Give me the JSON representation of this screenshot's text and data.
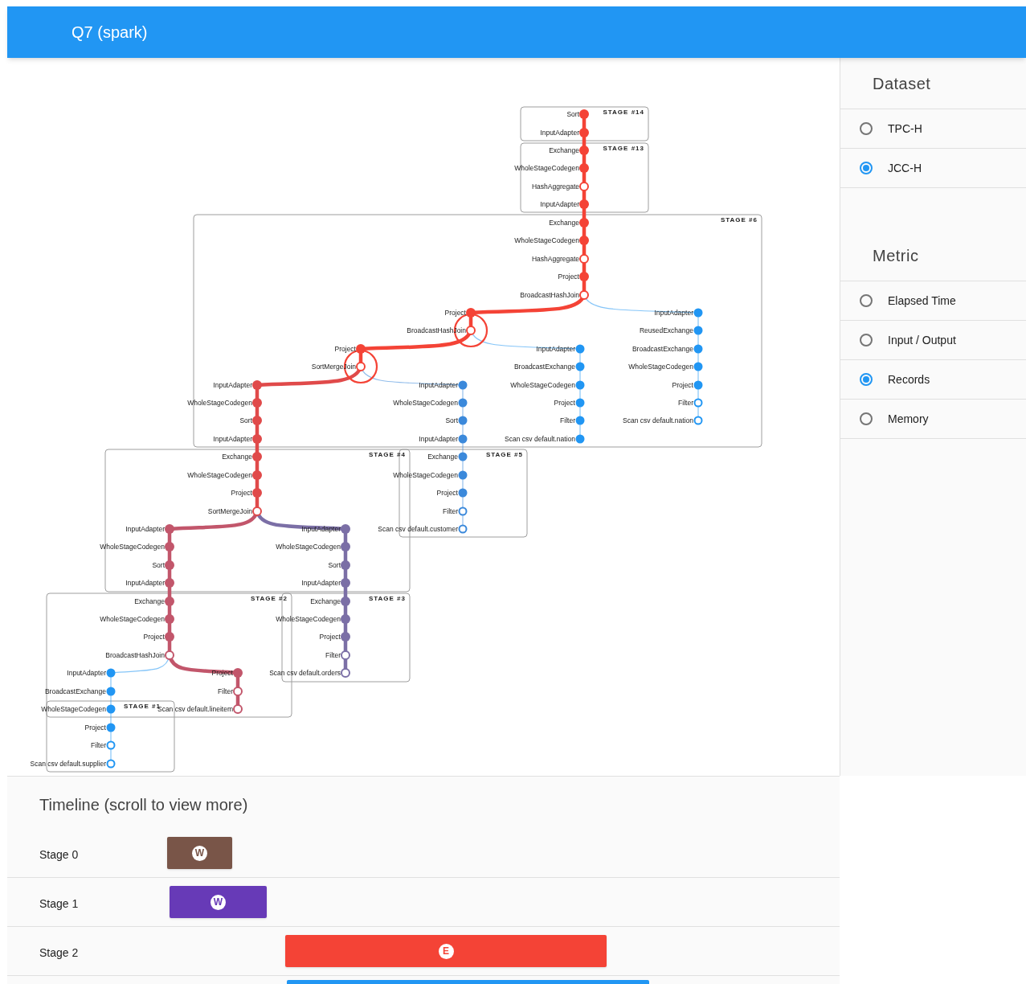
{
  "header": {
    "title": "Q7 (spark)"
  },
  "plan": {
    "stages": [
      {
        "label": "STAGE #14"
      },
      {
        "label": "STAGE #13"
      },
      {
        "label": "STAGE #6"
      },
      {
        "label": "STAGE #4"
      },
      {
        "label": "STAGE #5"
      },
      {
        "label": "STAGE #2"
      },
      {
        "label": "STAGE #3"
      },
      {
        "label": "STAGE #1"
      }
    ],
    "tree": [
      {
        "color": "#f44336",
        "thick": true,
        "nodes": [
          {
            "label": "Sort",
            "filled": true,
            "highlighted": false
          },
          {
            "label": "InputAdapter",
            "filled": true,
            "highlighted": false
          },
          {
            "label": "Exchange",
            "filled": true,
            "highlighted": false
          },
          {
            "label": "WholeStageCodegen",
            "filled": true,
            "highlighted": false
          },
          {
            "label": "HashAggregate",
            "filled": false,
            "highlighted": false
          },
          {
            "label": "InputAdapter",
            "filled": true,
            "highlighted": false
          },
          {
            "label": "Exchange",
            "filled": true,
            "highlighted": false
          },
          {
            "label": "WholeStageCodegen",
            "filled": true,
            "highlighted": false
          },
          {
            "label": "HashAggregate",
            "filled": false,
            "highlighted": false
          },
          {
            "label": "Project",
            "filled": true,
            "highlighted": false
          },
          {
            "label": "BroadcastHashJoin",
            "filled": false,
            "highlighted": false
          }
        ],
        "children": [
          {
            "color": "#f44336",
            "thick": true,
            "nodes": [
              {
                "label": "Project",
                "filled": true,
                "highlighted": false
              },
              {
                "label": "BroadcastHashJoin",
                "filled": false,
                "highlighted": true
              }
            ],
            "children": [
              {
                "color": "#f44336",
                "thick": true,
                "nodes": [
                  {
                    "label": "Project",
                    "filled": true,
                    "highlighted": false
                  },
                  {
                    "label": "SortMergeJoin",
                    "filled": false,
                    "highlighted": true
                  }
                ],
                "children": [
                  {
                    "color": "#e04a4a",
                    "thick": true,
                    "nodes": [
                      {
                        "label": "InputAdapter",
                        "filled": true,
                        "highlighted": false
                      },
                      {
                        "label": "WholeStageCodegen",
                        "filled": true,
                        "highlighted": false
                      },
                      {
                        "label": "Sort",
                        "filled": true,
                        "highlighted": false
                      },
                      {
                        "label": "InputAdapter",
                        "filled": true,
                        "highlighted": false
                      },
                      {
                        "label": "Exchange",
                        "filled": true,
                        "highlighted": false
                      },
                      {
                        "label": "WholeStageCodegen",
                        "filled": true,
                        "highlighted": false
                      },
                      {
                        "label": "Project",
                        "filled": true,
                        "highlighted": false
                      },
                      {
                        "label": "SortMergeJoin",
                        "filled": false,
                        "highlighted": false
                      }
                    ],
                    "children": [
                      {
                        "color": "#c2566b",
                        "thick": true,
                        "nodes": [
                          {
                            "label": "InputAdapter",
                            "filled": true,
                            "highlighted": false
                          },
                          {
                            "label": "WholeStageCodegen",
                            "filled": true,
                            "highlighted": false
                          },
                          {
                            "label": "Sort",
                            "filled": true,
                            "highlighted": false
                          },
                          {
                            "label": "InputAdapter",
                            "filled": true,
                            "highlighted": false
                          },
                          {
                            "label": "Exchange",
                            "filled": true,
                            "highlighted": false
                          },
                          {
                            "label": "WholeStageCodegen",
                            "filled": true,
                            "highlighted": false
                          },
                          {
                            "label": "Project",
                            "filled": true,
                            "highlighted": false
                          },
                          {
                            "label": "BroadcastHashJoin",
                            "filled": false,
                            "highlighted": false
                          }
                        ],
                        "children": [
                          {
                            "color": "#2196f3",
                            "thick": false,
                            "nodes": [
                              {
                                "label": "InputAdapter",
                                "filled": true,
                                "highlighted": false
                              },
                              {
                                "label": "BroadcastExchange",
                                "filled": true,
                                "highlighted": false
                              },
                              {
                                "label": "WholeStageCodegen",
                                "filled": true,
                                "highlighted": false
                              },
                              {
                                "label": "Project",
                                "filled": true,
                                "highlighted": false
                              },
                              {
                                "label": "Filter",
                                "filled": false,
                                "highlighted": false
                              },
                              {
                                "label": "Scan csv default.supplier",
                                "filled": false,
                                "highlighted": false
                              }
                            ]
                          },
                          {
                            "color": "#c2566b",
                            "thick": true,
                            "nodes": [
                              {
                                "label": "Project",
                                "filled": true,
                                "highlighted": false
                              },
                              {
                                "label": "Filter",
                                "filled": false,
                                "highlighted": false
                              },
                              {
                                "label": "Scan csv default.lineitem",
                                "filled": false,
                                "highlighted": false
                              }
                            ]
                          }
                        ]
                      },
                      {
                        "color": "#7b6fa6",
                        "thick": true,
                        "nodes": [
                          {
                            "label": "InputAdapter",
                            "filled": true,
                            "highlighted": false
                          },
                          {
                            "label": "WholeStageCodegen",
                            "filled": true,
                            "highlighted": false
                          },
                          {
                            "label": "Sort",
                            "filled": true,
                            "highlighted": false
                          },
                          {
                            "label": "InputAdapter",
                            "filled": true,
                            "highlighted": false
                          },
                          {
                            "label": "Exchange",
                            "filled": true,
                            "highlighted": false
                          },
                          {
                            "label": "WholeStageCodegen",
                            "filled": true,
                            "highlighted": false
                          },
                          {
                            "label": "Project",
                            "filled": true,
                            "highlighted": false
                          },
                          {
                            "label": "Filter",
                            "filled": false,
                            "highlighted": false
                          },
                          {
                            "label": "Scan csv default.orders",
                            "filled": false,
                            "highlighted": false
                          }
                        ]
                      }
                    ]
                  },
                  {
                    "color": "#3b89db",
                    "thick": false,
                    "nodes": [
                      {
                        "label": "InputAdapter",
                        "filled": true,
                        "highlighted": false
                      },
                      {
                        "label": "WholeStageCodegen",
                        "filled": true,
                        "highlighted": false
                      },
                      {
                        "label": "Sort",
                        "filled": true,
                        "highlighted": false
                      },
                      {
                        "label": "InputAdapter",
                        "filled": true,
                        "highlighted": false
                      },
                      {
                        "label": "Exchange",
                        "filled": true,
                        "highlighted": false
                      },
                      {
                        "label": "WholeStageCodegen",
                        "filled": true,
                        "highlighted": false
                      },
                      {
                        "label": "Project",
                        "filled": true,
                        "highlighted": false
                      },
                      {
                        "label": "Filter",
                        "filled": false,
                        "highlighted": false
                      },
                      {
                        "label": "Scan csv default.customer",
                        "filled": false,
                        "highlighted": false
                      }
                    ]
                  }
                ]
              },
              {
                "color": "#2196f3",
                "thick": false,
                "nodes": [
                  {
                    "label": "InputAdapter",
                    "filled": true,
                    "highlighted": false
                  },
                  {
                    "label": "BroadcastExchange",
                    "filled": true,
                    "highlighted": false
                  },
                  {
                    "label": "WholeStageCodegen",
                    "filled": true,
                    "highlighted": false
                  },
                  {
                    "label": "Project",
                    "filled": true,
                    "highlighted": false
                  },
                  {
                    "label": "Filter",
                    "filled": true,
                    "highlighted": false
                  },
                  {
                    "label": "Scan csv default.nation",
                    "filled": true,
                    "highlighted": false
                  }
                ]
              }
            ]
          },
          {
            "color": "#2196f3",
            "thick": false,
            "nodes": [
              {
                "label": "InputAdapter",
                "filled": true,
                "highlighted": false
              },
              {
                "label": "ReusedExchange",
                "filled": true,
                "highlighted": false
              },
              {
                "label": "BroadcastExchange",
                "filled": true,
                "highlighted": false
              },
              {
                "label": "WholeStageCodegen",
                "filled": true,
                "highlighted": false
              },
              {
                "label": "Project",
                "filled": true,
                "highlighted": false
              },
              {
                "label": "Filter",
                "filled": false,
                "highlighted": false
              },
              {
                "label": "Scan csv default.nation",
                "filled": false,
                "highlighted": false
              }
            ]
          }
        ]
      }
    ]
  },
  "sidebar": {
    "dataset": {
      "heading": "Dataset",
      "options": [
        {
          "label": "TPC-H",
          "selected": false
        },
        {
          "label": "JCC-H",
          "selected": true
        }
      ]
    },
    "metric": {
      "heading": "Metric",
      "options": [
        {
          "label": "Elapsed Time",
          "selected": false
        },
        {
          "label": "Input / Output",
          "selected": false
        },
        {
          "label": "Records",
          "selected": true
        },
        {
          "label": "Memory",
          "selected": false
        }
      ]
    }
  },
  "timeline": {
    "title": "Timeline (scroll to view more)",
    "rows": [
      {
        "label": "Stage 0",
        "badge": "W",
        "color": "#795548"
      },
      {
        "label": "Stage 1",
        "badge": "W",
        "color": "#673ab7"
      },
      {
        "label": "Stage 2",
        "badge": "E",
        "color": "#f44336"
      },
      {
        "color": "#2196f3"
      }
    ]
  }
}
